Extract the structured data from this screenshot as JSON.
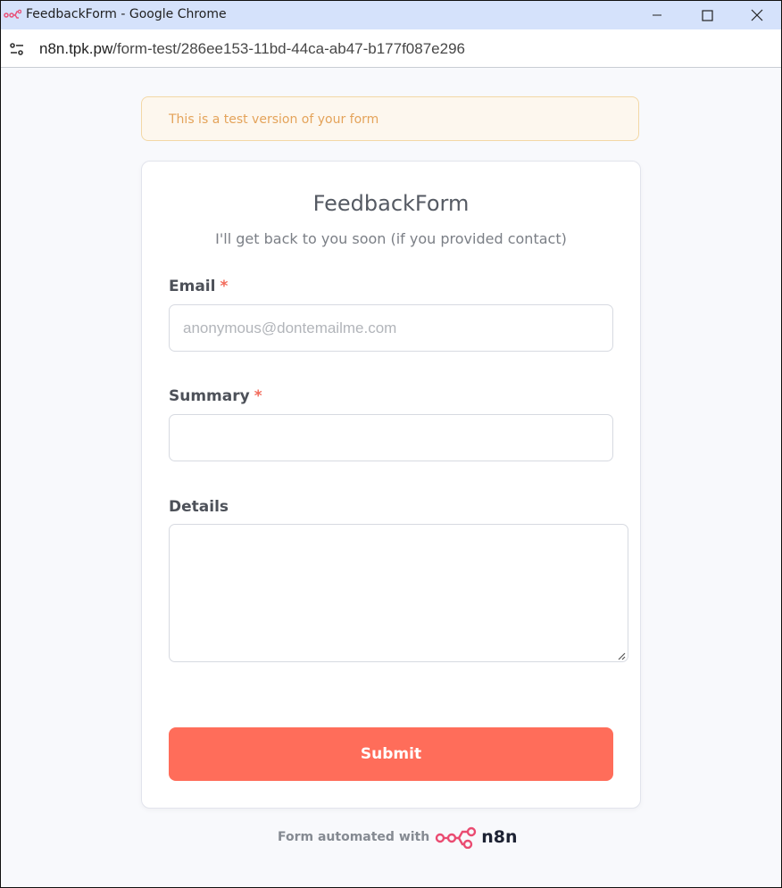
{
  "window": {
    "title": "FeedbackForm - Google Chrome"
  },
  "address_bar": {
    "host": "n8n.tpk.pw",
    "path": "/form-test/286ee153-11bd-44ca-ab47-b177f087e296"
  },
  "banner": {
    "text": "This is a test version of your form"
  },
  "form": {
    "title": "FeedbackForm",
    "description": "I'll get back to you soon (if you provided contact)",
    "fields": [
      {
        "label": "Email",
        "required_mark": "*",
        "placeholder": "anonymous@dontemailme.com",
        "value": ""
      },
      {
        "label": "Summary",
        "required_mark": "*",
        "placeholder": "",
        "value": ""
      },
      {
        "label": "Details",
        "value": ""
      }
    ],
    "submit_label": "Submit"
  },
  "footer": {
    "text": "Form automated with",
    "brand": "n8n"
  },
  "colors": {
    "accent": "#ff6d5a",
    "titlebar": "#d5e2fb",
    "banner_text": "#e4a35a",
    "banner_border": "#f3d8a6"
  },
  "icons": [
    "n8n-app-icon",
    "minimize-icon",
    "maximize-icon",
    "close-icon",
    "site-settings-icon",
    "resize-grip-icon",
    "n8n-logo-icon"
  ]
}
